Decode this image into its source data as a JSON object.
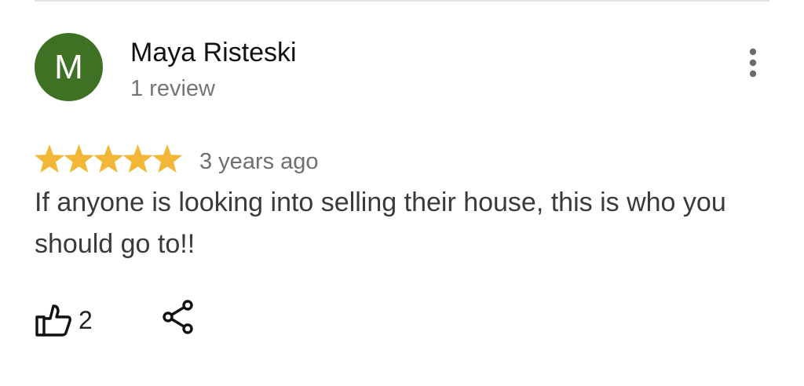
{
  "review": {
    "avatar_letter": "M",
    "avatar_color": "#3f7125",
    "reviewer_name": "Maya Risteski",
    "review_count": "1 review",
    "rating": 5,
    "max_rating": 5,
    "star_color": "#f2b736",
    "time": "3 years ago",
    "text": "If anyone is looking into selling their house, this is who you should go to!!",
    "like_count": "2"
  },
  "icons": {
    "more": "more-vert-icon",
    "like": "thumb-up-icon",
    "share": "share-icon",
    "star": "star-icon"
  }
}
